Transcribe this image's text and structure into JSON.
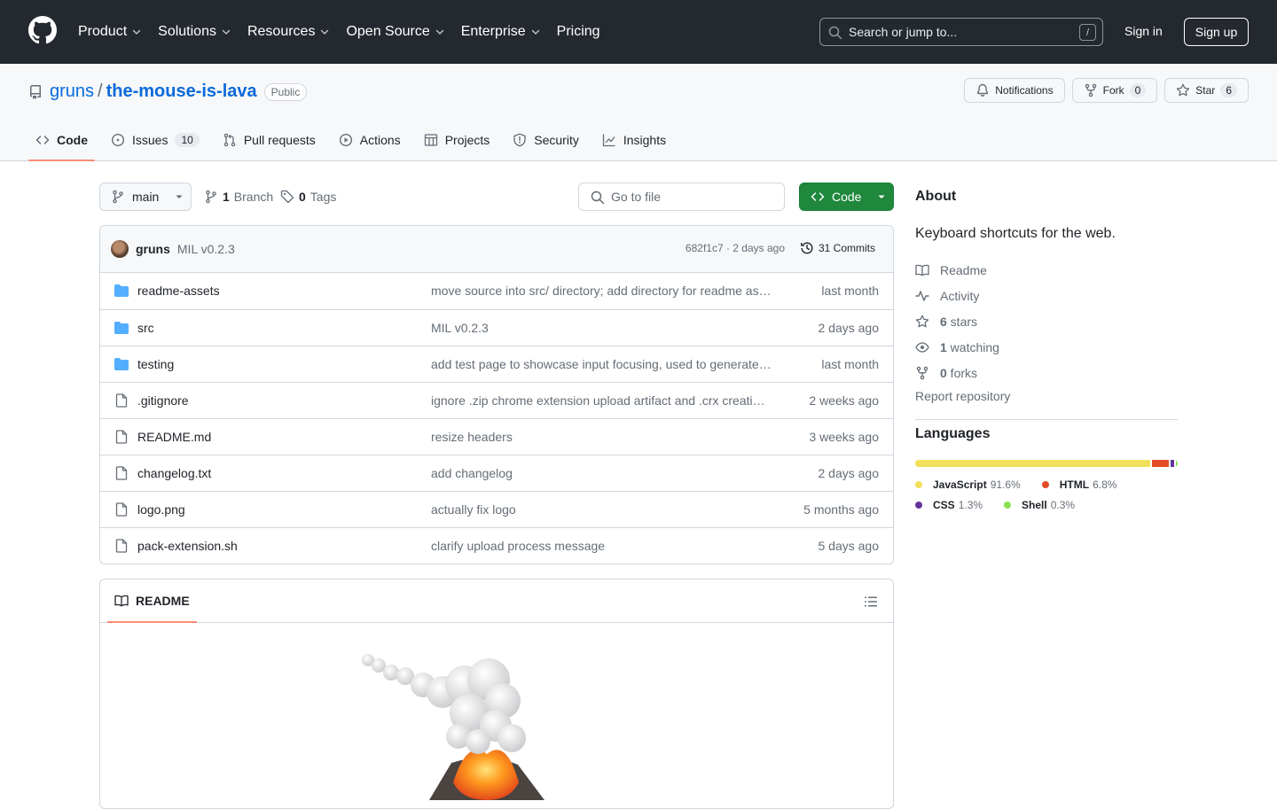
{
  "header": {
    "nav": [
      {
        "label": "Product",
        "has_menu": true
      },
      {
        "label": "Solutions",
        "has_menu": true
      },
      {
        "label": "Resources",
        "has_menu": true
      },
      {
        "label": "Open Source",
        "has_menu": true
      },
      {
        "label": "Enterprise",
        "has_menu": true
      },
      {
        "label": "Pricing",
        "has_menu": false
      }
    ],
    "search_placeholder": "Search or jump to...",
    "search_shortcut": "/",
    "sign_in": "Sign in",
    "sign_up": "Sign up"
  },
  "repo": {
    "owner": "gruns",
    "separator": "/",
    "name": "the-mouse-is-lava",
    "visibility": "Public",
    "notifications_label": "Notifications",
    "fork_label": "Fork",
    "fork_count": "0",
    "star_label": "Star",
    "star_count": "6"
  },
  "tabs": [
    {
      "label": "Code",
      "icon": "code-icon",
      "active": true,
      "count": ""
    },
    {
      "label": "Issues",
      "icon": "issue-icon",
      "active": false,
      "count": "10"
    },
    {
      "label": "Pull requests",
      "icon": "pull-request-icon",
      "active": false,
      "count": ""
    },
    {
      "label": "Actions",
      "icon": "play-icon",
      "active": false,
      "count": ""
    },
    {
      "label": "Projects",
      "icon": "table-icon",
      "active": false,
      "count": ""
    },
    {
      "label": "Security",
      "icon": "shield-icon",
      "active": false,
      "count": ""
    },
    {
      "label": "Insights",
      "icon": "graph-icon",
      "active": false,
      "count": ""
    }
  ],
  "toolbar": {
    "branch": "main",
    "branch_count": "1",
    "branch_label": "Branch",
    "tag_count": "0",
    "tag_label": "Tags",
    "goto_file": "Go to file",
    "code_button": "Code"
  },
  "latest_commit": {
    "user": "gruns",
    "message": "MIL v0.2.3",
    "hash_date": "682f1c7 · 2 days ago",
    "commits_label": "31 Commits"
  },
  "files": [
    {
      "type": "dir",
      "name": "readme-assets",
      "message": "move source into src/ directory; add directory for readme as…",
      "date": "last month"
    },
    {
      "type": "dir",
      "name": "src",
      "message": "MIL v0.2.3",
      "date": "2 days ago"
    },
    {
      "type": "dir",
      "name": "testing",
      "message": "add test page to showcase input focusing, used to generate…",
      "date": "last month"
    },
    {
      "type": "file",
      "name": ".gitignore",
      "message": "ignore .zip chrome extension upload artifact and .crx creati…",
      "date": "2 weeks ago"
    },
    {
      "type": "file",
      "name": "README.md",
      "message": "resize headers",
      "date": "3 weeks ago"
    },
    {
      "type": "file",
      "name": "changelog.txt",
      "message": "add changelog",
      "date": "2 days ago"
    },
    {
      "type": "file",
      "name": "logo.png",
      "message": "actually fix logo",
      "date": "5 months ago"
    },
    {
      "type": "file",
      "name": "pack-extension.sh",
      "message": "clarify upload process message",
      "date": "5 days ago"
    }
  ],
  "readme": {
    "tab_label": "README"
  },
  "about": {
    "heading": "About",
    "description": " Keyboard shortcuts for the web.",
    "readme": "Readme",
    "activity": "Activity",
    "stars_count": "6",
    "stars_label": " stars",
    "watching_count": "1",
    "watching_label": " watching",
    "forks_count": "0",
    "forks_label": " forks",
    "report": "Report repository"
  },
  "languages": {
    "heading": "Languages",
    "items": [
      {
        "name": "JavaScript",
        "percent": "91.6%",
        "value": 91.6,
        "color": "#f1e05a"
      },
      {
        "name": "HTML",
        "percent": "6.8%",
        "value": 6.8,
        "color": "#e34c26"
      },
      {
        "name": "CSS",
        "percent": "1.3%",
        "value": 1.3,
        "color": "#663399"
      },
      {
        "name": "Shell",
        "percent": "0.3%",
        "value": 0.3,
        "color": "#89e051"
      }
    ]
  },
  "colors": {
    "header_bg": "#24292f",
    "link_blue": "#0969da",
    "primary_green": "#1f883d",
    "folder_blue": "#54aeff",
    "active_tab_underline": "#fd8c73"
  }
}
